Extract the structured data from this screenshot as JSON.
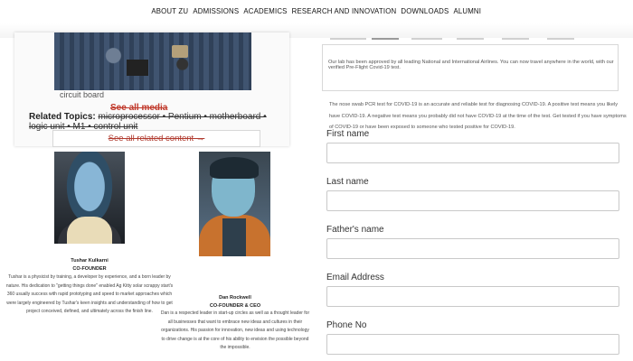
{
  "nav": {
    "items": [
      "ABOUT ZU",
      "ADMISSIONS",
      "ACADEMICS",
      "RESEARCH AND INNOVATION",
      "DOWNLOADS",
      "ALUMNI"
    ]
  },
  "left": {
    "caption": "circuit board",
    "see_all_media": "See all media",
    "related_label": "Related Topics:",
    "related_text": "microprocessor • Pentium • motherboard • logic unit • M1 • control unit",
    "see_all_content": "See all related content →"
  },
  "people": [
    {
      "name": "Tushar Kulkarni",
      "role": "CO-FOUNDER",
      "bio": "Tushar is a physicist by training, a developer by experience, and a born leader by nature. His dedication to \"getting things done\" enabled Ag Kitty solar scrappy start's 360 usually success with rapid prototyping and speed to market approaches which were largely engineered by Tushar's keen insights and understanding of how to get project conceived, defined, and ultimately across the finish line."
    },
    {
      "name": "Dan Rockwell",
      "role": "CO-FOUNDER & CEO",
      "bio": "Dan is a respected leader in start-up circles as well as a thought leader for all businesses that want to embrace new ideas and cultures in their organizations. His passion for innovation, new ideas and using technology to drive change is at the core of his ability to envision the possible beyond the impossible."
    }
  ],
  "notice": {
    "line1": "Our lab has been approved by all leading National and International Airlines. You can now travel anywhere in the world, with our verified Pre-Flight Covid-19 test.",
    "line2": "The nose swab PCR test for COVID-19 is an accurate and reliable test for diagnosing COVID-19. A positive test means you likely have COVID-19. A negative test means you probably did not have COVID-19 at the time of the test. Get tested if you have symptoms of COVID-19 or have been exposed to someone who tested positive for COVID-19."
  },
  "form": {
    "first_name_label": "First name",
    "last_name_label": "Last name",
    "father_name_label": "Father's name",
    "email_label": "Email Address",
    "phone_label": "Phone No"
  }
}
